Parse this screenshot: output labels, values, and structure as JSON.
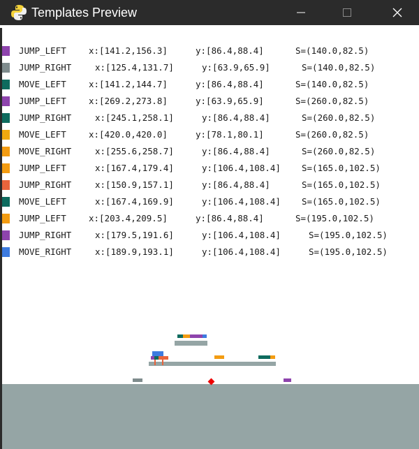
{
  "window": {
    "title": "Templates Preview",
    "icon": "python-snake-icon",
    "buttons": [
      "minimize-icon",
      "maximize-icon",
      "close-icon"
    ]
  },
  "templates": [
    {
      "color": "#8e44ad",
      "name": "JUMP_LEFT",
      "x": "x:[141.2,156.3]",
      "y": "y:[86.4,88.4]",
      "s": "S=(140.0,82.5)"
    },
    {
      "color": "#7f8c8d",
      "name": "JUMP_RIGHT",
      "x": "x:[125.4,131.7]",
      "y": "y:[63.9,65.9]",
      "s": "S=(140.0,82.5)"
    },
    {
      "color": "#0e6b5e",
      "name": "MOVE_LEFT",
      "x": "x:[141.2,144.7]",
      "y": "y:[86.4,88.4]",
      "s": "S=(140.0,82.5)"
    },
    {
      "color": "#8e44ad",
      "name": "JUMP_LEFT",
      "x": "x:[269.2,273.8]",
      "y": "y:[63.9,65.9]",
      "s": "S=(260.0,82.5)"
    },
    {
      "color": "#0e6b5e",
      "name": "JUMP_RIGHT",
      "x": "x:[245.1,258.1]",
      "y": "y:[86.4,88.4]",
      "s": "S=(260.0,82.5)"
    },
    {
      "color": "#f1a90f",
      "name": "MOVE_LEFT",
      "x": "x:[420.0,420.0]",
      "y": "y:[78.1,80.1]",
      "s": "S=(260.0,82.5)"
    },
    {
      "color": "#f39c12",
      "name": "MOVE_RIGHT",
      "x": "x:[255.6,258.7]",
      "y": "y:[86.4,88.4]",
      "s": "S=(260.0,82.5)"
    },
    {
      "color": "#f39c12",
      "name": "JUMP_LEFT",
      "x": "x:[167.4,179.4]",
      "y": "y:[106.4,108.4]",
      "s": "S=(165.0,102.5)"
    },
    {
      "color": "#e8643c",
      "name": "JUMP_RIGHT",
      "x": "x:[150.9,157.1]",
      "y": "y:[86.4,88.4]",
      "s": "S=(165.0,102.5)"
    },
    {
      "color": "#0e6b5e",
      "name": "MOVE_LEFT",
      "x": "x:[167.4,169.9]",
      "y": "y:[106.4,108.4]",
      "s": "S=(165.0,102.5)"
    },
    {
      "color": "#f39c12",
      "name": "JUMP_LEFT",
      "x": "x:[203.4,209.5]",
      "y": "y:[86.4,88.4]",
      "s": "S=(195.0,102.5)"
    },
    {
      "color": "#8e44ad",
      "name": "JUMP_RIGHT",
      "x": "x:[179.5,191.6]",
      "y": "y:[106.4,108.4]",
      "s": "S=(195.0,102.5)"
    },
    {
      "color": "#3d7be0",
      "name": "MOVE_RIGHT",
      "x": "x:[189.9,193.1]",
      "y": "y:[106.4,108.4]",
      "s": "S=(195.0,102.5)"
    }
  ],
  "scene": {
    "ground_color": "#95a5a5",
    "marker_color": "#ee0000"
  }
}
